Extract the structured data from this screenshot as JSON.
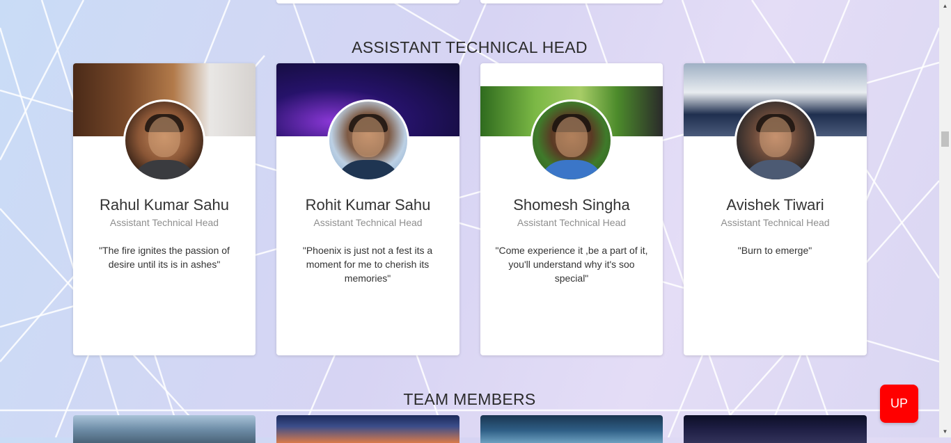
{
  "sections": {
    "assistant_title": "ASSISTANT TECHNICAL HEAD",
    "team_title": "TEAM MEMBERS"
  },
  "cards": [
    {
      "name": "Rahul Kumar Sahu",
      "role": "Assistant Technical Head",
      "quote": "\"The fire ignites the passion of desire until its is in ashes\""
    },
    {
      "name": "Rohit Kumar Sahu",
      "role": "Assistant Technical Head",
      "quote": "\"Phoenix is just not a fest its a moment for me to cherish its memories\""
    },
    {
      "name": "Shomesh Singha",
      "role": "Assistant Technical Head",
      "quote": "\"Come experience it ,be a part of it, you'll understand why it's soo special\""
    },
    {
      "name": "Avishek Tiwari",
      "role": "Assistant Technical Head",
      "quote": "\"Burn to emerge\""
    }
  ],
  "up_button": {
    "label": "UP"
  },
  "scrollbar": {
    "position_fraction": 0.3
  }
}
